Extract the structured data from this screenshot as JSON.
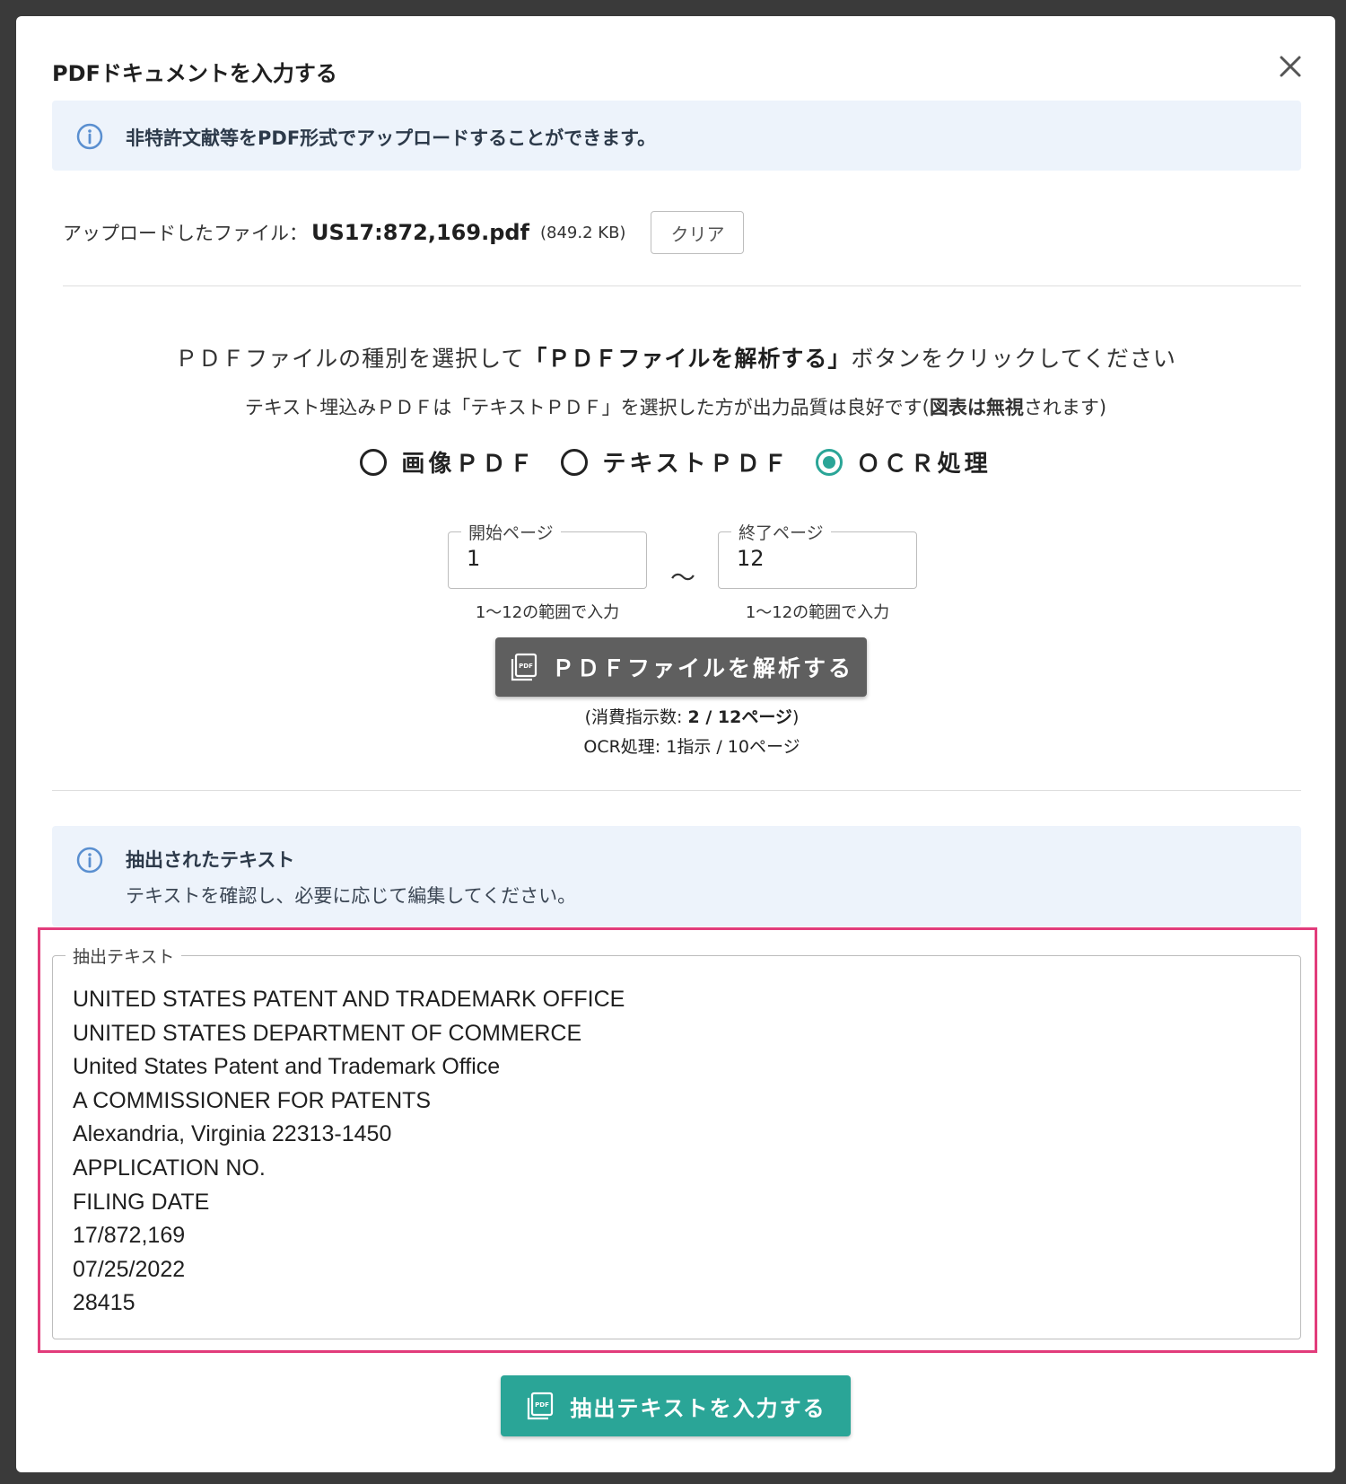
{
  "modal": {
    "title": "PDFドキュメントを入力する",
    "close_icon": "close-icon"
  },
  "info": {
    "icon": "info-icon",
    "text": "非特許文献等をPDF形式でアップロードすることができます。"
  },
  "upload": {
    "label": "アップロードしたファイル：",
    "filename": "US17:872,169.pdf",
    "size": "(849.2 KB)",
    "clear_label": "クリア"
  },
  "instructions": {
    "line1_pre": "ＰＤＦファイルの種別を選択して",
    "line1_bold": "「ＰＤＦファイルを解析する」",
    "line1_post": "ボタンをクリックしてください",
    "line2_pre": "テキスト埋込みＰＤＦは「テキストＰＤＦ」を選択した方が出力品質は良好です(",
    "line2_bold": "図表は無視",
    "line2_post": "されます)"
  },
  "pdf_type": {
    "options": [
      "画像ＰＤＦ",
      "テキストＰＤＦ",
      "ＯＣＲ処理"
    ],
    "selected": "ＯＣＲ処理"
  },
  "pages": {
    "start_label": "開始ページ",
    "start_value": "1",
    "start_helper": "1〜12の範囲で入力",
    "separator": "〜",
    "end_label": "終了ページ",
    "end_value": "12",
    "end_helper": "1〜12の範囲で入力"
  },
  "analyze": {
    "label": "ＰＤＦファイルを解析する",
    "icon": "pdf-icon",
    "cost_pre": "(消費指示数: ",
    "cost_bold": "2 / 12ページ",
    "cost_post": ")",
    "cost_detail": "OCR処理: 1指示 / 10ページ"
  },
  "extracted_info": {
    "icon": "info-icon",
    "title": "抽出されたテキスト",
    "subtitle": "テキストを確認し、必要に応じて編集してください。"
  },
  "extract_field": {
    "legend": "抽出テキスト",
    "lines": [
      "UNITED STATES PATENT AND TRADEMARK OFFICE",
      "UNITED STATES DEPARTMENT OF COMMERCE",
      "United States Patent and Trademark Office",
      "A COMMISSIONER FOR PATENTS",
      "Alexandria, Virginia 22313-1450",
      "APPLICATION NO.",
      "FILING DATE",
      "17/872,169",
      "07/25/2022",
      "28415"
    ]
  },
  "submit": {
    "label": "抽出テキストを入力する",
    "icon": "pdf-icon"
  },
  "colors": {
    "accent": "#2aa597",
    "highlight": "#e23c7b",
    "button_gray": "#5f5f5f",
    "info_bg": "#edf3fb"
  }
}
